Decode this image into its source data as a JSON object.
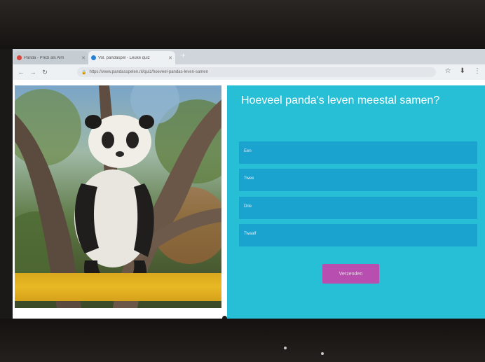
{
  "browser": {
    "tabs": [
      {
        "title": "Panda - Prezi als Alm"
      },
      {
        "title": "Vol. pandaspel - Leuke quiz"
      }
    ],
    "new_tab": "+",
    "url": "https://www.pandasspelen.nl/quiz/hoeveel-pandas-leven-samen",
    "nav": {
      "back": "←",
      "forward": "→",
      "reload": "↻"
    },
    "actions": {
      "star": "☆",
      "download": "⬇",
      "menu": "⋮"
    }
  },
  "quiz": {
    "question": "Hoeveel panda's leven meestal samen?",
    "answers": [
      {
        "label": "Een"
      },
      {
        "label": "Twee"
      },
      {
        "label": "Drie"
      },
      {
        "label": "Twaalf"
      }
    ],
    "submit_label": "Verzenden"
  },
  "colors": {
    "quiz_bg": "#26bfd6",
    "answer_bg": "#1ba3cf",
    "submit_bg": "#b84fb0",
    "accent_gold": "#e8b825"
  }
}
